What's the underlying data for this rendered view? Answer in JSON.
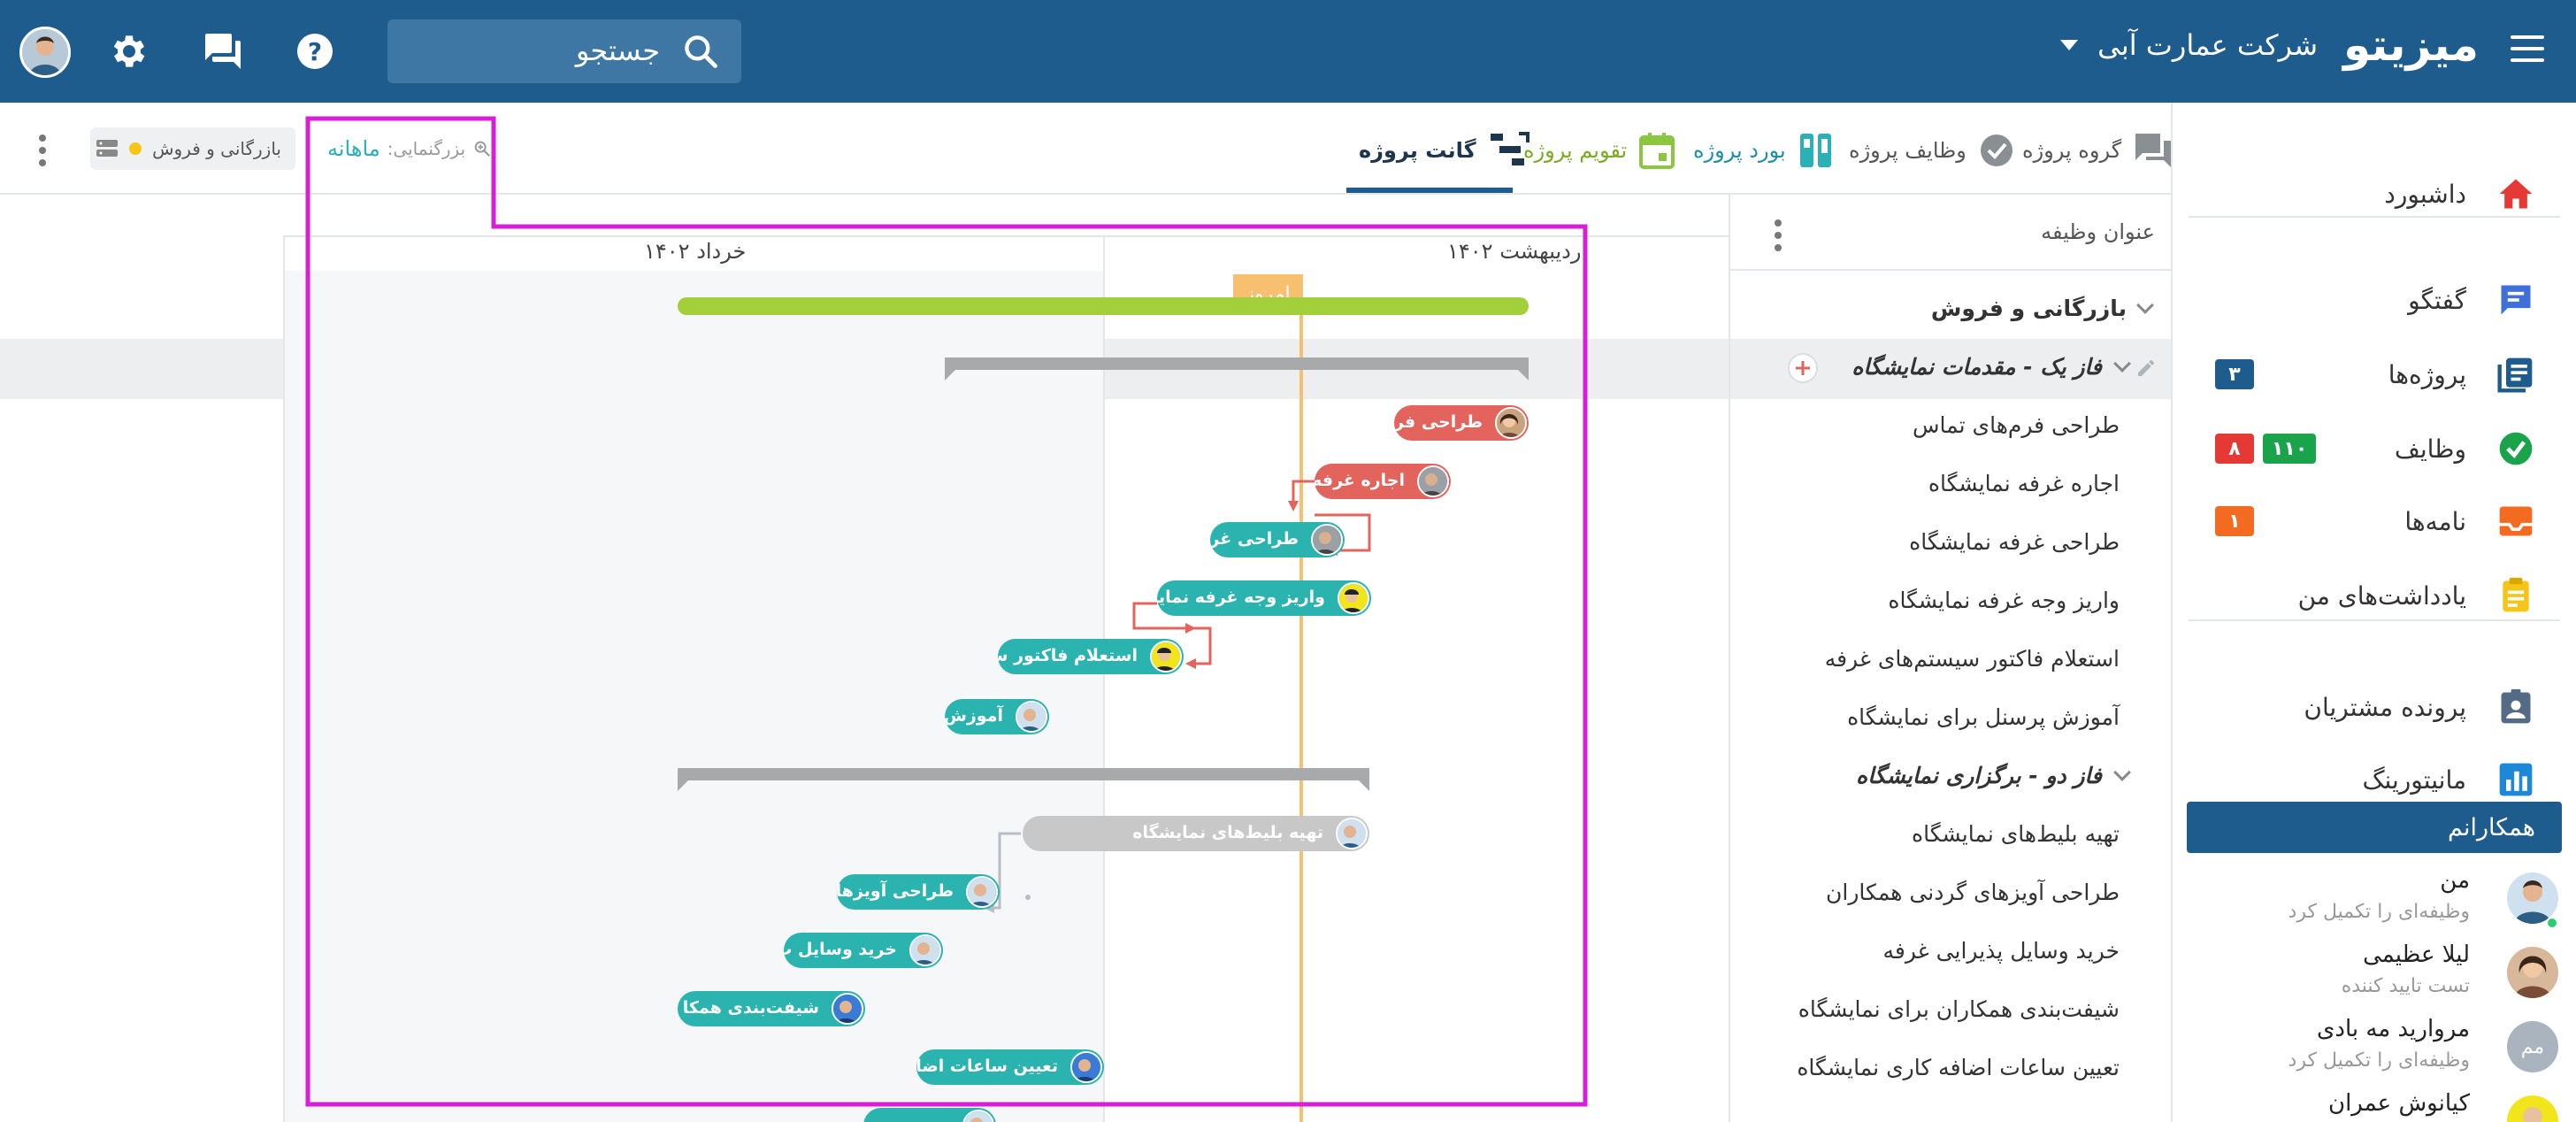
{
  "topbar": {
    "brand": "میزیتو",
    "company": "شرکت عمارت آبی",
    "search_label": "جستجو"
  },
  "sidebar": {
    "items": [
      {
        "label": "داشبورد",
        "icon": "home-icon"
      },
      {
        "label": "گفتگو",
        "icon": "chat-icon"
      },
      {
        "label": "پروژه‌ها",
        "icon": "projects-icon",
        "badges": [
          "۳"
        ]
      },
      {
        "label": "وظایف",
        "icon": "tasks-icon",
        "badges": [
          "۱۱۰",
          "۸"
        ]
      },
      {
        "label": "نامه‌ها",
        "icon": "letters-icon",
        "badges": [
          "۱"
        ]
      },
      {
        "label": "یادداشت‌های من",
        "icon": "notes-icon"
      },
      {
        "label": "پرونده مشتریان",
        "icon": "customers-icon"
      },
      {
        "label": "مانیتورینگ",
        "icon": "monitoring-icon"
      }
    ],
    "team_title": "همکارانم",
    "members": [
      {
        "name": "من",
        "role": "وظیفه‌ای را تکمیل کرد"
      },
      {
        "name": "لیلا عظیمی",
        "role": "تست تایید کننده"
      },
      {
        "name": "مروارید مه بادی",
        "role": "وظیفه‌ای را تکمیل کرد",
        "initials": "مم"
      },
      {
        "name": "کیانوش عمران",
        "role": ""
      }
    ]
  },
  "tabs": [
    {
      "label": "گروه پروژه",
      "icon": "project-group-icon"
    },
    {
      "label": "وظایف پروژه",
      "icon": "check-circle-icon"
    },
    {
      "label": "بورد پروژه",
      "icon": "board-icon"
    },
    {
      "label": "تقویم پروژه",
      "icon": "calendar-icon"
    },
    {
      "label": "گانت پروژه",
      "icon": "gantt-icon"
    }
  ],
  "zoom": {
    "label": "بزرگنمایی:",
    "value": "ماهانه"
  },
  "filter_chip": "بازرگانی و فروش",
  "task_list": {
    "header": "عنوان وظیفه",
    "project": "بازرگانی و فروش",
    "rows": [
      {
        "label": "فاز یک - مقدمات نمایشگاه",
        "type": "group"
      },
      {
        "label": "طراحی فرم‌های تماس",
        "type": "task"
      },
      {
        "label": "اجاره غرفه نمایشگاه",
        "type": "task"
      },
      {
        "label": "طراحی غرفه نمایشگاه",
        "type": "task"
      },
      {
        "label": "واریز وجه غرفه نمایشگاه",
        "type": "task"
      },
      {
        "label": "استعلام فاکتور سیستم‌های غرفه",
        "type": "task"
      },
      {
        "label": "آموزش پرسنل برای نمایشگاه",
        "type": "task"
      },
      {
        "label": "فاز دو - برگزاری نمایشگاه",
        "type": "group"
      },
      {
        "label": "تهیه بلیط‌های نمایشگاه",
        "type": "task"
      },
      {
        "label": "طراحی آویزهای گردنی همکاران",
        "type": "task"
      },
      {
        "label": "خرید وسایل پذیرایی غرفه",
        "type": "task"
      },
      {
        "label": "شیفت‌بندی همکاران برای نمایشگاه",
        "type": "task"
      },
      {
        "label": "تعیین ساعات اضافه کاری نمایشگاه",
        "type": "task"
      }
    ]
  },
  "gantt": {
    "months": [
      "اردیبهشت ۱۴۰۲",
      "خرداد ۱۴۰۲"
    ],
    "today_label": "امروز",
    "bars": [
      {
        "label": "طراحی فره",
        "color": "red"
      },
      {
        "label": "اجاره غرفه",
        "color": "red"
      },
      {
        "label": "طراحی غرا",
        "color": "teal"
      },
      {
        "label": "واریز وجه غرفه نمایش",
        "color": "teal"
      },
      {
        "label": "استعلام فاکتور س",
        "color": "teal"
      },
      {
        "label": "آموزش",
        "color": "teal"
      },
      {
        "label": "تهیه بلیط‌های نمایشگاه",
        "color": "gray"
      },
      {
        "label": "طراحی آویزهای",
        "color": "teal"
      },
      {
        "label": "خرید وسایل پ",
        "color": "teal"
      },
      {
        "label": "شیفت‌بندی همکا",
        "color": "teal"
      },
      {
        "label": "تعیین ساعات اضا",
        "color": "teal"
      }
    ]
  },
  "colors": {
    "brand_blue": "#1e5c8e",
    "accent_teal": "#2ab0b7",
    "bar_red": "#e3635d",
    "bar_teal": "#2bb3b0",
    "progress_green": "#a3cf3b",
    "today_orange": "#f6c070",
    "highlight_magenta": "#d61fd6"
  }
}
